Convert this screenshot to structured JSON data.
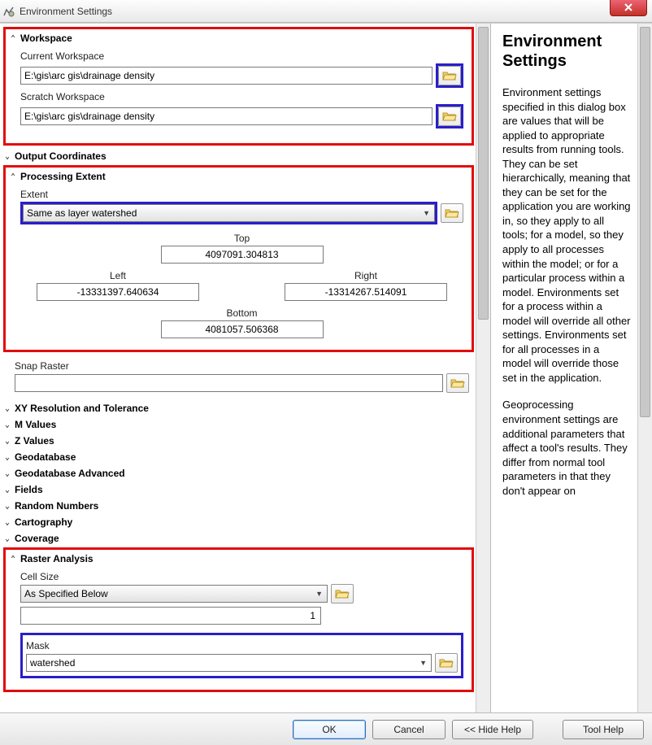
{
  "window": {
    "title": "Environment Settings"
  },
  "sections": {
    "workspace": {
      "title": "Workspace",
      "current_label": "Current Workspace",
      "current_value": "E:\\gis\\arc gis\\drainage density",
      "scratch_label": "Scratch Workspace",
      "scratch_value": "E:\\gis\\arc gis\\drainage density"
    },
    "output_coords": {
      "title": "Output Coordinates"
    },
    "processing_extent": {
      "title": "Processing Extent",
      "extent_label": "Extent",
      "extent_value": "Same as layer watershed",
      "top_label": "Top",
      "top_value": "4097091.304813",
      "left_label": "Left",
      "left_value": "-13331397.640634",
      "right_label": "Right",
      "right_value": "-13314267.514091",
      "bottom_label": "Bottom",
      "bottom_value": "4081057.506368",
      "snap_label": "Snap Raster",
      "snap_value": ""
    },
    "xy_res": {
      "title": "XY Resolution and Tolerance"
    },
    "m_values": {
      "title": "M Values"
    },
    "z_values": {
      "title": "Z Values"
    },
    "geodb": {
      "title": "Geodatabase"
    },
    "geodb_adv": {
      "title": "Geodatabase Advanced"
    },
    "fields": {
      "title": "Fields"
    },
    "random": {
      "title": "Random Numbers"
    },
    "carto": {
      "title": "Cartography"
    },
    "coverage": {
      "title": "Coverage"
    },
    "raster": {
      "title": "Raster Analysis",
      "cell_label": "Cell Size",
      "cell_select": "As Specified Below",
      "cell_value": "1",
      "mask_label": "Mask",
      "mask_value": "watershed"
    }
  },
  "help": {
    "title": "Environment Settings",
    "p1": "Environment settings specified in this dialog box are values that will be applied to appropriate results from running tools. They can be set hierarchically, meaning that they can be set for the application you are working in, so they apply to all tools; for a model, so they apply to all processes within the model; or for a particular process within a model. Environments set for a process within a model will override all other settings. Environments set for all processes in a model will override those set in the application.",
    "p2": "Geoprocessing environment settings are additional parameters that affect a tool's results. They differ from normal tool parameters in that they don't appear on"
  },
  "buttons": {
    "ok": "OK",
    "cancel": "Cancel",
    "hidehelp": "<< Hide Help",
    "toolhelp": "Tool Help"
  }
}
